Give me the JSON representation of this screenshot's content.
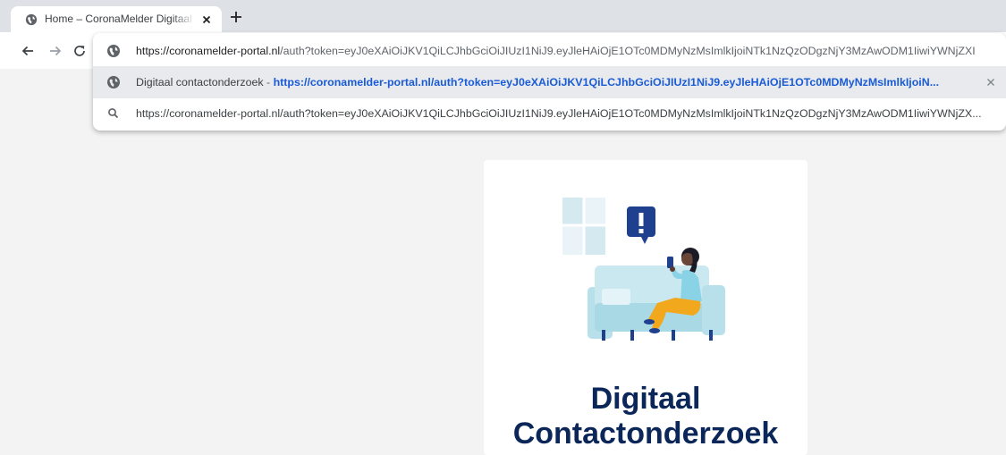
{
  "browser": {
    "tab": {
      "title": "Home – CoronaMelder Digitaal Contactonderzoek"
    }
  },
  "omnibox": {
    "input": {
      "host": "https://coronamelder-portal.nl",
      "rest": "/auth?token=eyJ0eXAiOiJKV1QiLCJhbGciOiJIUzI1NiJ9.eyJleHAiOjE1OTc0MDMyNzMsImlkIjoiNTk1NzQzODgzNjY3MzAwODM1IiwiYWNjZXI"
    },
    "suggestion": {
      "title": "Digitaal contactonderzoek",
      "separator": " - ",
      "url": "https://coronamelder-portal.nl/auth?token=eyJ0eXAiOiJKV1QiLCJhbGciOiJIUzI1NiJ9.eyJleHAiOjE1OTc0MDMyNzMsImlkIjoiN..."
    },
    "search": {
      "text": "https://coronamelder-portal.nl/auth?token=eyJ0eXAiOiJKV1QiLCJhbGciOiJIUzI1NiJ9.eyJleHAiOjE1OTc0MDMyNzMsImlkIjoiNTk1NzQzODgzNjY3MzAwODM1IiwiYWNjZX..."
    }
  },
  "page": {
    "title": "Digitaal Contactonderzoek"
  },
  "colors": {
    "title": "#0b2659",
    "accent": "#1a5bd6",
    "tabstrip": "#dee1e6"
  },
  "icons": [
    "globe-icon",
    "close-icon",
    "plus-icon",
    "back-arrow-icon",
    "forward-arrow-icon",
    "reload-icon",
    "search-icon"
  ]
}
